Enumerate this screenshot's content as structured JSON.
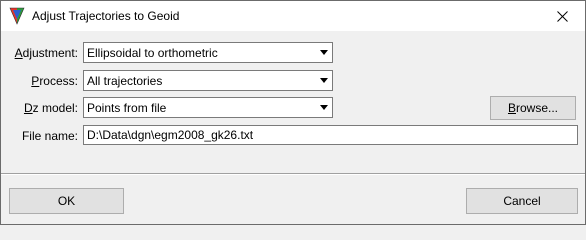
{
  "window": {
    "title": "Adjust Trajectories to Geoid",
    "app_icon": "triangle-logo-icon",
    "close_icon": "close-icon"
  },
  "form": {
    "adjustment": {
      "label_mnemonic": "A",
      "label_rest": "djustment:",
      "value": "Ellipsoidal to orthometric"
    },
    "process": {
      "label_mnemonic": "P",
      "label_rest": "rocess:",
      "value": "All trajectories"
    },
    "dz_model": {
      "label_mnemonic": "D",
      "label_rest": "z model:",
      "value": "Points from file"
    },
    "file_name": {
      "label": "File name:",
      "value": "D:\\Data\\dgn\\egm2008_gk26.txt"
    }
  },
  "buttons": {
    "browse_mnemonic": "B",
    "browse_rest": "rowse...",
    "ok": "OK",
    "cancel": "Cancel"
  }
}
